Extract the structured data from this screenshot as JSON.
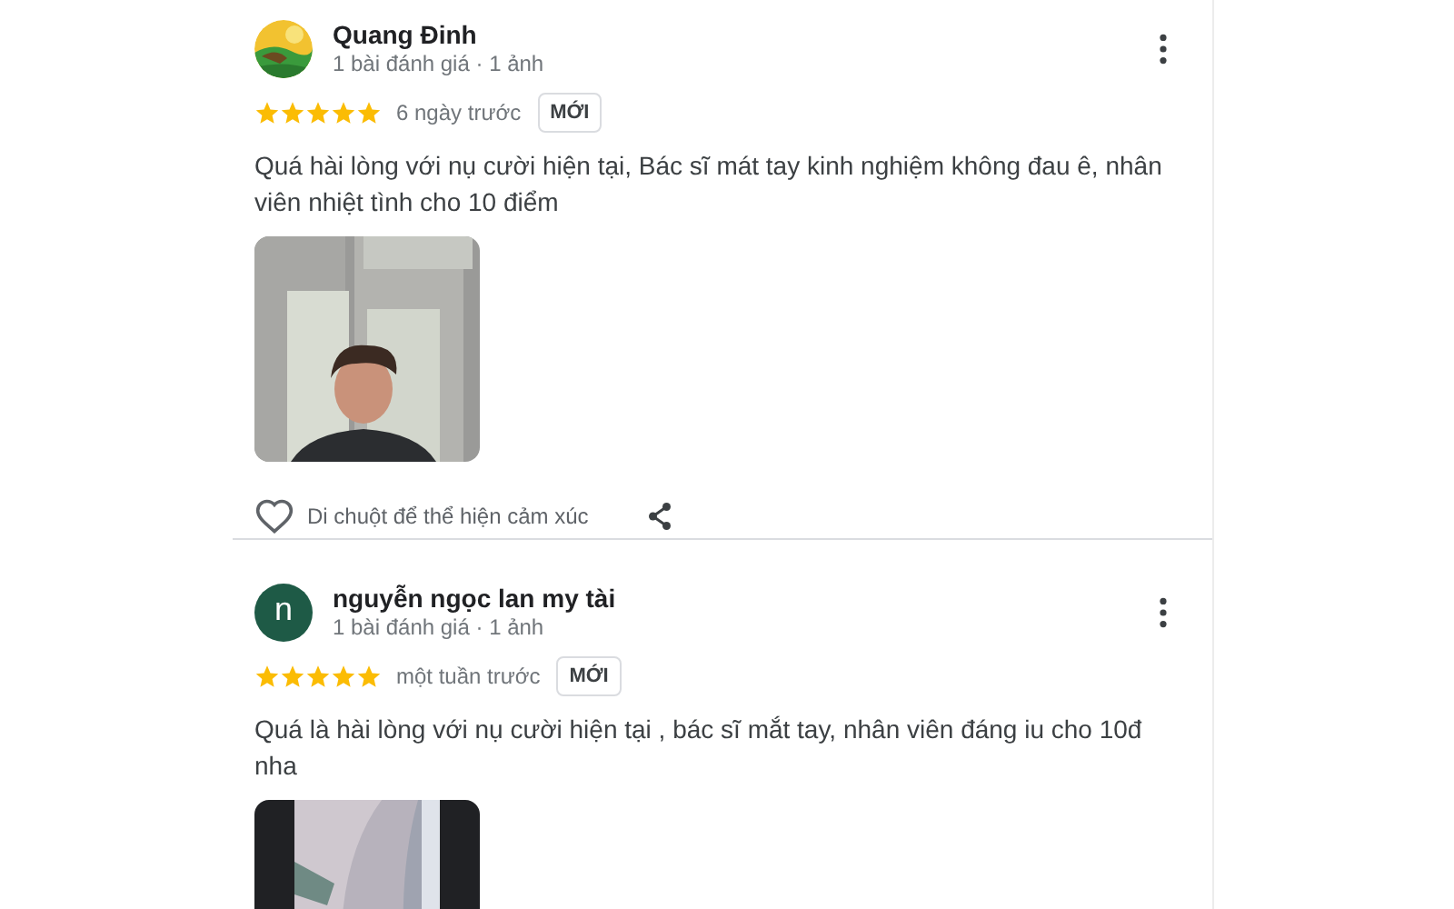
{
  "reviews": [
    {
      "name": "Quang Đinh",
      "meta": "1 bài đánh giá · 1 ảnh",
      "stars": 5,
      "time": "6 ngày trước",
      "badge": "MỚI",
      "text": "Quá hài lòng với nụ cười hiện tại, Bác sĩ mát tay kinh nghiệm không đau ê, nhân viên nhiệt tình cho 10 điểm",
      "photo": {
        "kind": "portrait"
      },
      "reaction_hint": "Di chuột để thể hiện cảm xúc"
    },
    {
      "avatar": {
        "kind": "letter",
        "letter": "n",
        "color": "#1e5a46"
      },
      "name": "nguyễn ngọc lan my tài",
      "meta": "1 bài đánh giá · 1 ảnh",
      "stars": 5,
      "time": "một tuần trước",
      "badge": "MỚI",
      "text": "Quá là hài lòng với nụ cười hiện tại , bác sĩ mắt tay, nhân viên đáng iu cho 10đ nha",
      "photo": {
        "kind": "interior"
      }
    }
  ]
}
